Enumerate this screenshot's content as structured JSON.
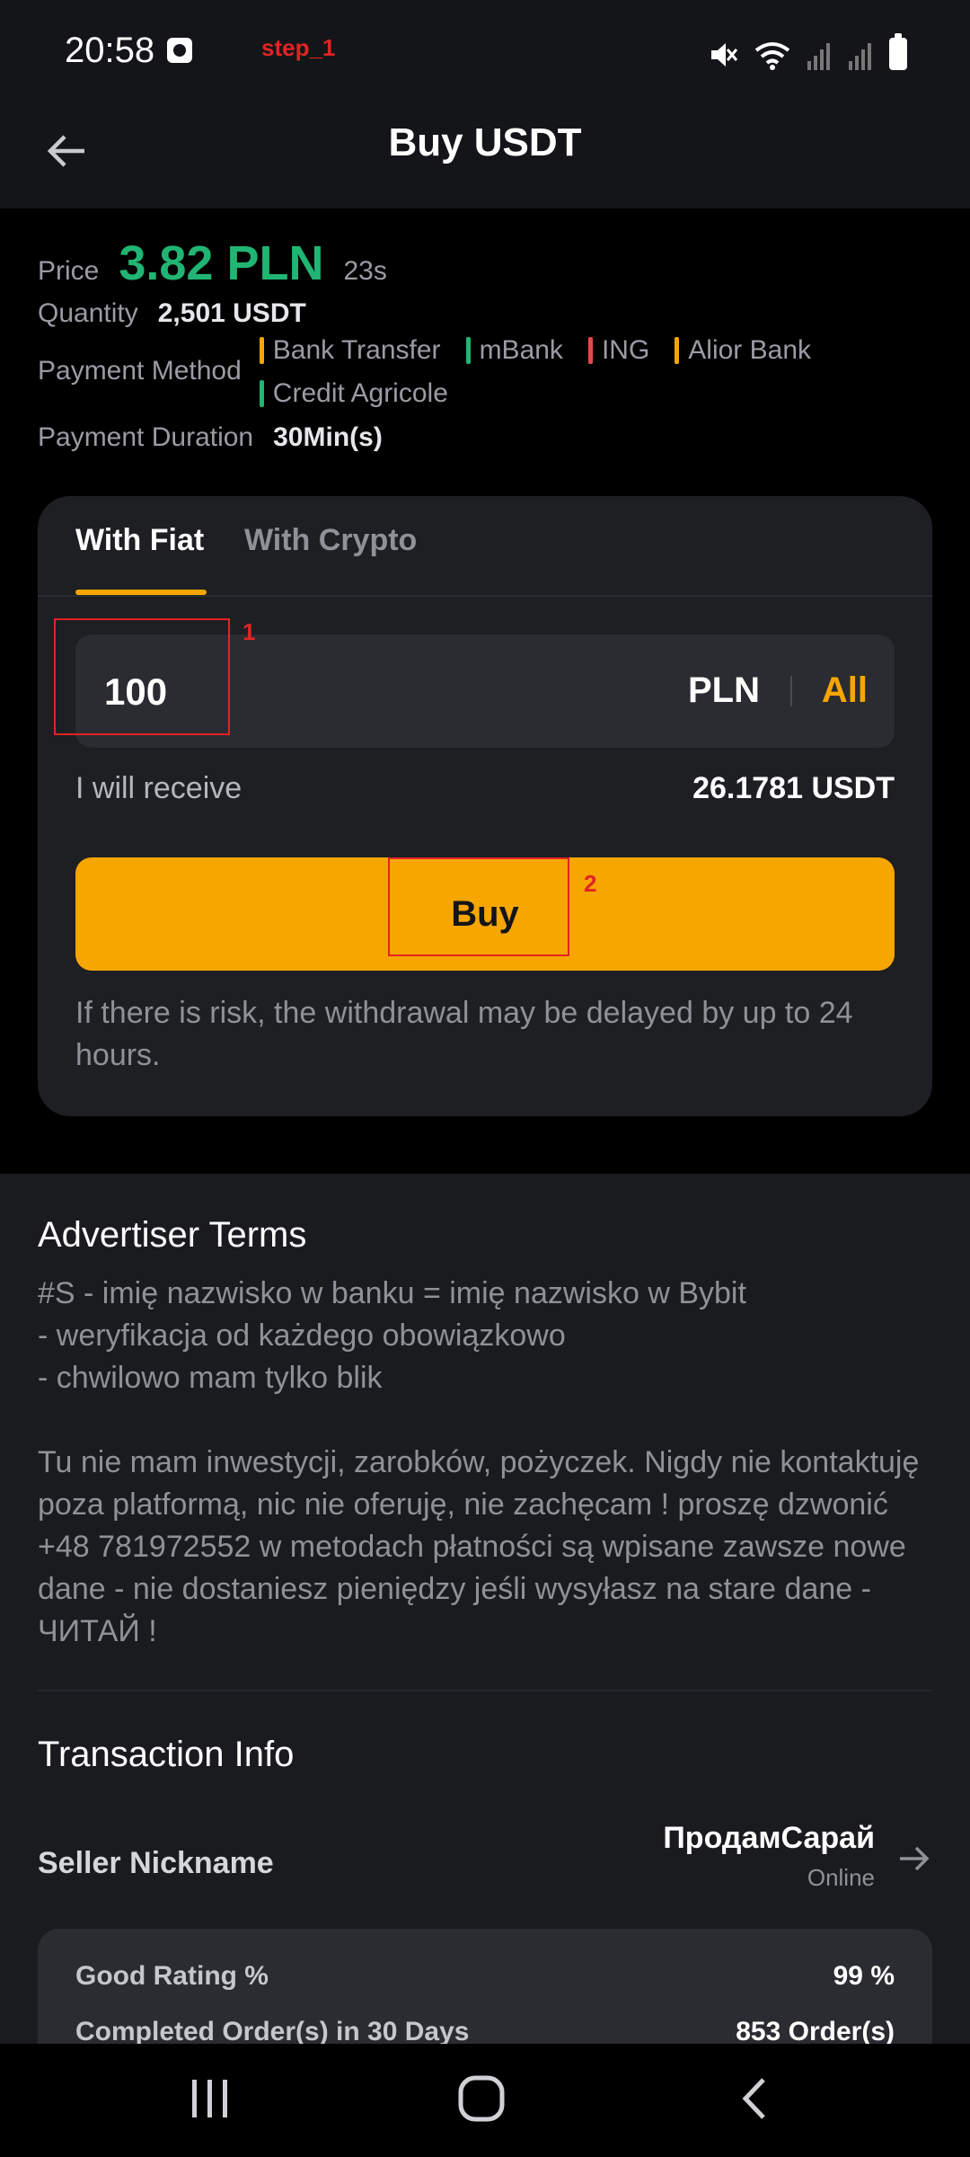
{
  "status_bar": {
    "time": "20:58",
    "step_label": "step_1",
    "icons": [
      "alarm-icon",
      "mute-icon",
      "wifi-icon",
      "signal-icon",
      "battery-icon"
    ]
  },
  "header": {
    "title": "Buy USDT"
  },
  "order": {
    "price_label": "Price",
    "price_value": "3.82 PLN",
    "price_timer": "23s",
    "quantity_label": "Quantity",
    "quantity_value": "2,501 USDT",
    "payment_method_label": "Payment Method",
    "payment_methods": [
      {
        "name": "Bank Transfer",
        "color": "#f7a600"
      },
      {
        "name": "mBank",
        "color": "#21b573"
      },
      {
        "name": "ING",
        "color": "#e8474e"
      },
      {
        "name": "Alior Bank",
        "color": "#f7a600"
      },
      {
        "name": "Credit Agricole",
        "color": "#21b573"
      }
    ],
    "duration_label": "Payment Duration",
    "duration_value": "30Min(s)"
  },
  "buy_card": {
    "tabs": [
      "With Fiat",
      "With Crypto"
    ],
    "active_tab": "With Fiat",
    "amount_value": "100",
    "amount_currency": "PLN",
    "all_label": "All",
    "receive_label": "I will receive",
    "receive_value": "26.1781 USDT",
    "buy_label": "Buy",
    "risk_note": "If there is risk, the withdrawal may be delayed by up to 24 hours."
  },
  "annotations": [
    "1",
    "2"
  ],
  "advertiser_terms": {
    "title": "Advertiser Terms",
    "text": "#S - imię nazwisko w banku = imię nazwisko w Bybit\n- weryfikacja od każdego obowiązkowo\n- chwilowo mam tylko blik\n\nTu nie mam inwestycji, zarobków, pożyczek. Nigdy nie kontaktuję poza platformą, nic nie oferuję, nie zachęcam ! proszę dzwonić +48  781972552  w metodach płatności są wpisane zawsze nowe dane - nie dostaniesz pieniędzy jeśli wysyłasz na stare dane - ЧИТАЙ !"
  },
  "transaction_info": {
    "title": "Transaction Info",
    "seller_label": "Seller Nickname",
    "seller_name": "ПродамСарай",
    "seller_status": "Online",
    "stats": [
      {
        "label": "Good Rating %",
        "value": "99 %"
      },
      {
        "label": "Completed Order(s) in 30 Days",
        "value": "853 Order(s)"
      }
    ]
  },
  "nav_bar": {
    "buttons": [
      "recent-apps",
      "home",
      "back"
    ]
  }
}
